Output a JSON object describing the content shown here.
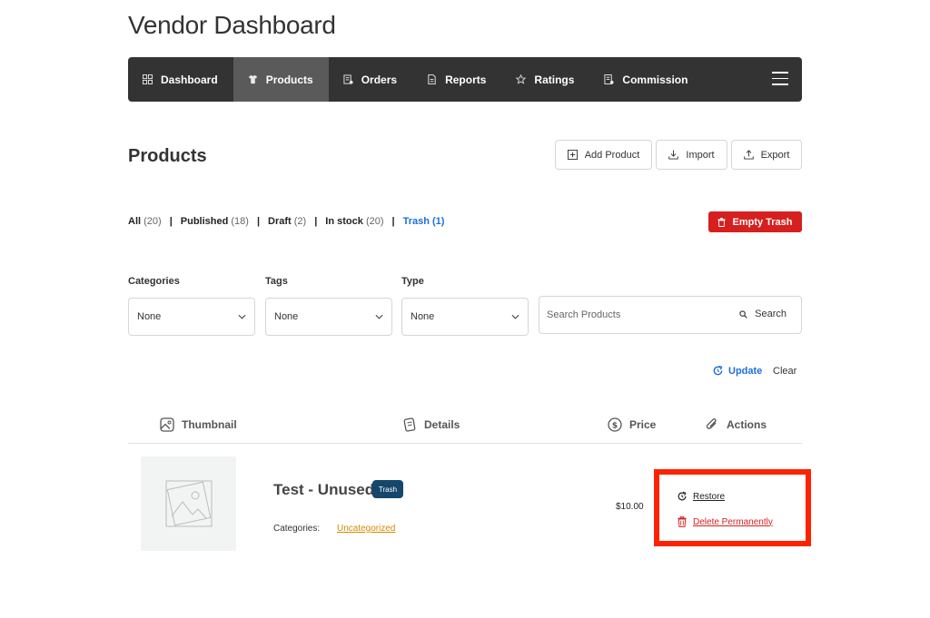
{
  "page": {
    "title": "Vendor Dashboard"
  },
  "nav": {
    "items": [
      {
        "label": "Dashboard",
        "icon": "grid-icon"
      },
      {
        "label": "Products",
        "icon": "shirt-icon",
        "active": true
      },
      {
        "label": "Orders",
        "icon": "receipt-icon"
      },
      {
        "label": "Reports",
        "icon": "document-icon"
      },
      {
        "label": "Ratings",
        "icon": "star-icon"
      },
      {
        "label": "Commission",
        "icon": "ledger-icon"
      }
    ],
    "menu_icon": "hamburger-menu-icon"
  },
  "products": {
    "title": "Products",
    "buttons": {
      "add": "Add Product",
      "import": "Import",
      "export": "Export"
    }
  },
  "filters": [
    {
      "label": "All",
      "count": "(20)"
    },
    {
      "label": "Published",
      "count": "(18)"
    },
    {
      "label": "Draft",
      "count": "(2)"
    },
    {
      "label": "In stock",
      "count": "(20)"
    },
    {
      "label": "Trash",
      "count": "(1)",
      "active": true
    }
  ],
  "empty_trash": "Empty Trash",
  "selects": {
    "categories": {
      "label": "Categories",
      "value": "None"
    },
    "tags": {
      "label": "Tags",
      "value": "None"
    },
    "type": {
      "label": "Type",
      "value": "None"
    }
  },
  "search": {
    "placeholder": "Search Products",
    "button": "Search"
  },
  "update": "Update",
  "clear": "Clear",
  "table": {
    "headers": {
      "thumbnail": "Thumbnail",
      "details": "Details",
      "price": "Price",
      "actions": "Actions"
    },
    "rows": [
      {
        "name": "Test - Unused",
        "badge": "Trash",
        "categories_label": "Categories:",
        "category": "Uncategorized",
        "price": "$10.00",
        "actions": {
          "restore": "Restore",
          "delete": "Delete Permanently"
        }
      }
    ]
  },
  "colors": {
    "navbar": "#333333",
    "nav_active": "#5a5a5a",
    "link_blue": "#1e6fd9",
    "danger": "#d61f1f",
    "badge": "#15466b",
    "category_link": "#d48a00",
    "highlight": "#ff2200"
  }
}
